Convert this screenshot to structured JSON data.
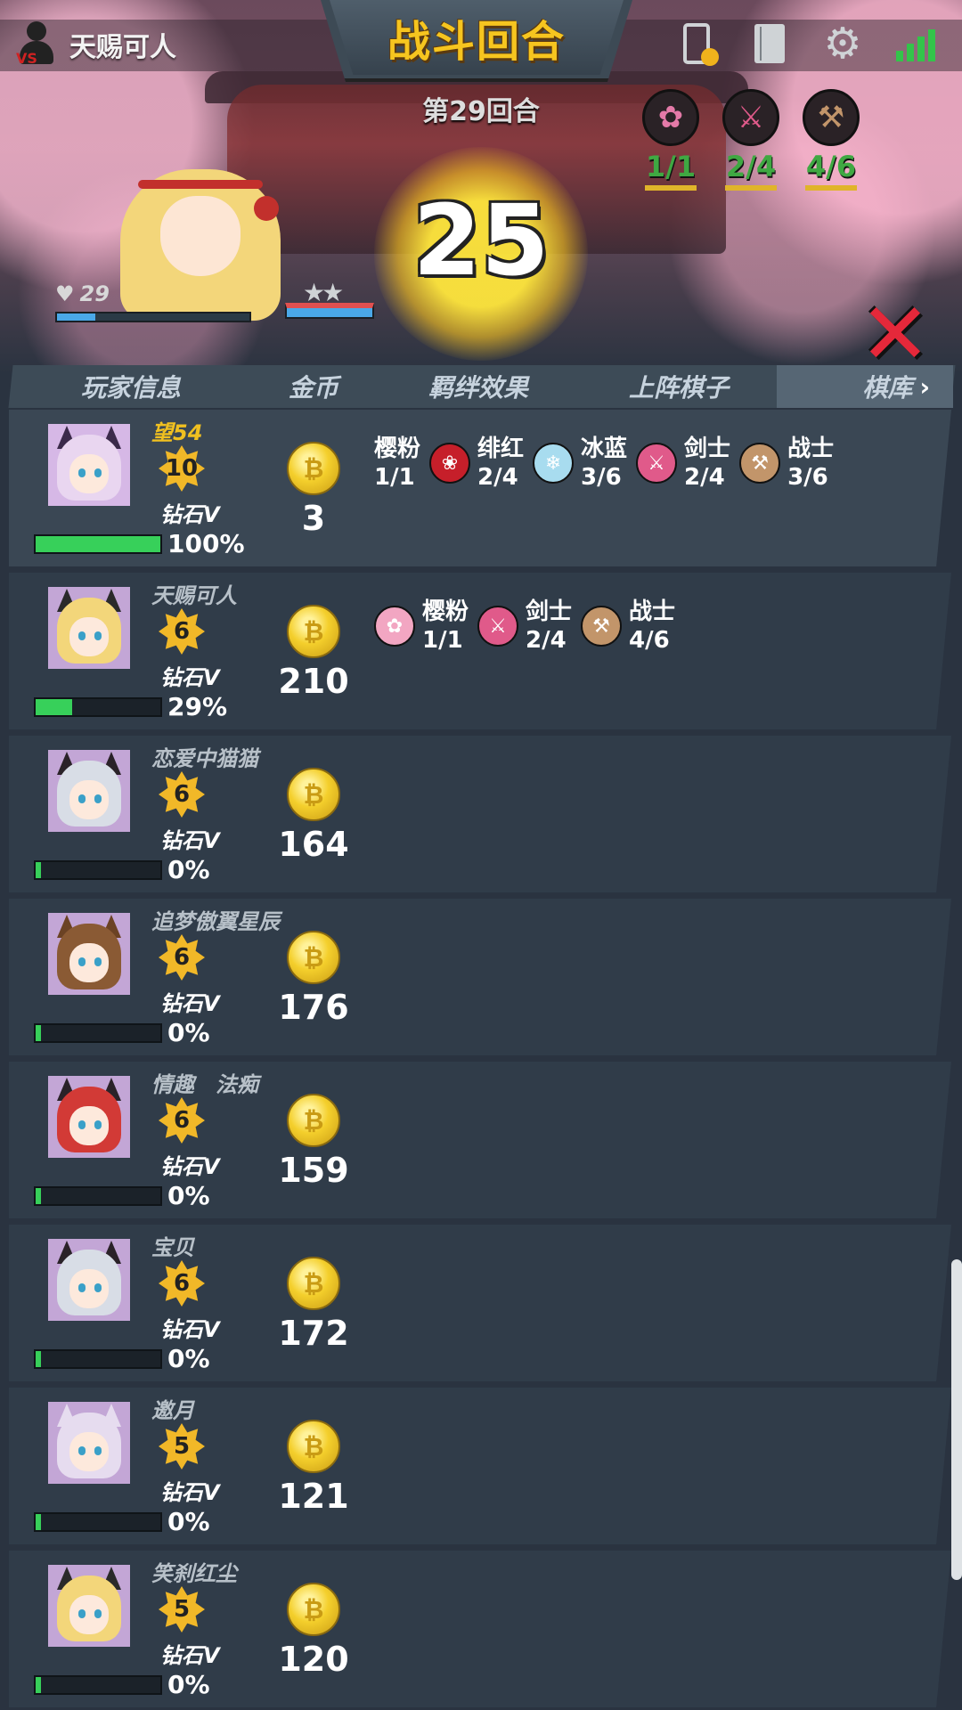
{
  "top": {
    "player_name": "天赐可人",
    "round_title": "战斗回合",
    "round_number_text": "第29回合",
    "countdown": "25",
    "hp": "29",
    "synergies": [
      {
        "icon": "cherry-blossom",
        "count": "1/1",
        "color": "#e47aa8"
      },
      {
        "icon": "sword",
        "count": "2/4",
        "color": "#e05a8a"
      },
      {
        "icon": "hammer",
        "count": "4/6",
        "color": "#c2956a"
      }
    ]
  },
  "tabs": [
    {
      "label": "玩家信息"
    },
    {
      "label": "金币"
    },
    {
      "label": "羁绊效果"
    },
    {
      "label": "上阵棋子"
    },
    {
      "label": "棋库",
      "chevron": "›"
    }
  ],
  "players": [
    {
      "name": "望54",
      "level": "10",
      "rank": "钻石V",
      "xp": 100,
      "xp_text": "100%",
      "gold": "3",
      "avatar_hair": "#e9d6f0",
      "avatar_bg": "#d6b8e6",
      "avatar_ear": "#3b2a4a",
      "synergies": [
        {
          "name": "樱粉",
          "count": "1/1",
          "badge": "",
          "badge_color": ""
        },
        {
          "name": "绯红",
          "count": "2/4",
          "badge": "rose-icon",
          "badge_color": "#c61f2a"
        },
        {
          "name": "冰蓝",
          "count": "3/6",
          "badge": "snowflake-icon",
          "badge_color": "#a8dcef"
        },
        {
          "name": "剑士",
          "count": "2/4",
          "badge": "sword-icon",
          "badge_color": "#e05a8a"
        },
        {
          "name": "战士",
          "count": "3/6",
          "badge": "hammer-icon",
          "badge_color": "#c2956a"
        }
      ]
    },
    {
      "name": "天赐可人",
      "level": "6",
      "rank": "钻石V",
      "xp": 29,
      "xp_text": "29%",
      "gold": "210",
      "avatar_hair": "#f3d67a",
      "avatar_bg": "#c3a6d6",
      "avatar_ear": "#2a2a2a",
      "synergies": [
        {
          "name": "樱粉",
          "count": "1/1",
          "badge": "cherry-blossom-icon",
          "badge_color": "#f2a6c2"
        },
        {
          "name": "剑士",
          "count": "2/4",
          "badge": "sword-icon",
          "badge_color": "#e05a8a"
        },
        {
          "name": "战士",
          "count": "4/6",
          "badge": "hammer-icon",
          "badge_color": "#c2956a"
        }
      ]
    },
    {
      "name": "恋爱中猫猫",
      "level": "6",
      "rank": "钻石V",
      "xp": 0,
      "xp_text": "0%",
      "gold": "164",
      "avatar_hair": "#d8dde6",
      "avatar_bg": "#c3a6d6",
      "avatar_ear": "#2a2228",
      "synergies": []
    },
    {
      "name": "追梦傲翼星辰",
      "level": "6",
      "rank": "钻石V",
      "xp": 0,
      "xp_text": "0%",
      "gold": "176",
      "avatar_hair": "#8a5a34",
      "avatar_bg": "#c3a6d6",
      "avatar_ear": "#6b4224",
      "synergies": []
    },
    {
      "name": "情趣　法痴",
      "level": "6",
      "rank": "钻石V",
      "xp": 0,
      "xp_text": "0%",
      "gold": "159",
      "avatar_hair": "#d23a36",
      "avatar_bg": "#c3a6d6",
      "avatar_ear": "#2a2228",
      "synergies": []
    },
    {
      "name": "宝贝",
      "level": "6",
      "rank": "钻石V",
      "xp": 0,
      "xp_text": "0%",
      "gold": "172",
      "avatar_hair": "#d8dde6",
      "avatar_bg": "#c3a6d6",
      "avatar_ear": "#2a2228",
      "synergies": []
    },
    {
      "name": "邀月",
      "level": "5",
      "rank": "钻石V",
      "xp": 0,
      "xp_text": "0%",
      "gold": "121",
      "avatar_hair": "#e6dcef",
      "avatar_bg": "#c3a6d6",
      "avatar_ear": "#e6dcef",
      "synergies": []
    },
    {
      "name": "笑刹红尘",
      "level": "5",
      "rank": "钻石V",
      "xp": 0,
      "xp_text": "0%",
      "gold": "120",
      "avatar_hair": "#f3d67a",
      "avatar_bg": "#c3a6d6",
      "avatar_ear": "#2a2a2a",
      "synergies": []
    }
  ],
  "close_label": "✕"
}
